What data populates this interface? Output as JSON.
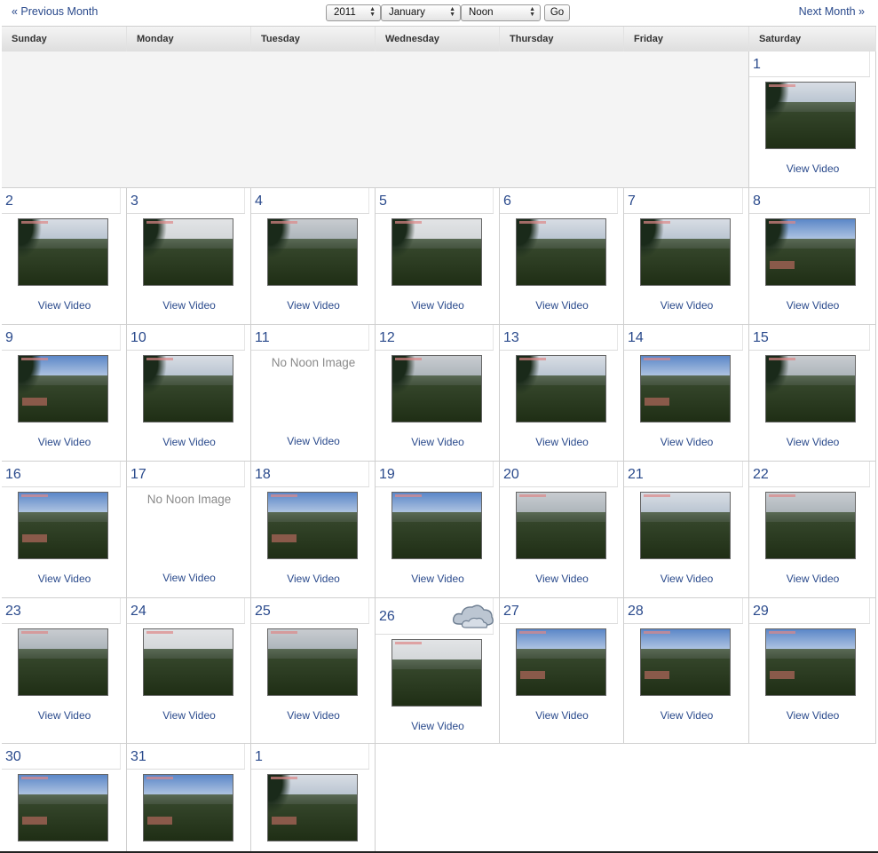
{
  "nav": {
    "prev_label": "« Previous Month",
    "next_label": "Next Month »",
    "year": "2011",
    "month": "January",
    "time": "Noon",
    "go_label": "Go"
  },
  "weekdays": [
    "Sunday",
    "Monday",
    "Tuesday",
    "Wednesday",
    "Thursday",
    "Friday",
    "Saturday"
  ],
  "view_video_label": "View Video",
  "no_image_label": "No Noon Image",
  "days": [
    {
      "label": "1",
      "image": true,
      "sky": "cloud",
      "roof": false,
      "palm": true
    },
    {
      "label": "2",
      "image": true,
      "sky": "cloud",
      "roof": false,
      "palm": true
    },
    {
      "label": "3",
      "image": true,
      "sky": "fog",
      "roof": false,
      "palm": true
    },
    {
      "label": "4",
      "image": true,
      "sky": "grey",
      "roof": false,
      "palm": true
    },
    {
      "label": "5",
      "image": true,
      "sky": "fog",
      "roof": false,
      "palm": true
    },
    {
      "label": "6",
      "image": true,
      "sky": "cloud",
      "roof": false,
      "palm": true
    },
    {
      "label": "7",
      "image": true,
      "sky": "cloud",
      "roof": false,
      "palm": true
    },
    {
      "label": "8",
      "image": true,
      "sky": "blue",
      "roof": true,
      "palm": true
    },
    {
      "label": "9",
      "image": true,
      "sky": "blue",
      "roof": true,
      "palm": true
    },
    {
      "label": "10",
      "image": true,
      "sky": "cloud",
      "roof": false,
      "palm": true
    },
    {
      "label": "11",
      "image": false
    },
    {
      "label": "12",
      "image": true,
      "sky": "grey",
      "roof": false,
      "palm": true
    },
    {
      "label": "13",
      "image": true,
      "sky": "cloud",
      "roof": false,
      "palm": true
    },
    {
      "label": "14",
      "image": true,
      "sky": "blue",
      "roof": true,
      "palm": false
    },
    {
      "label": "15",
      "image": true,
      "sky": "grey",
      "roof": false,
      "palm": true
    },
    {
      "label": "16",
      "image": true,
      "sky": "blue",
      "roof": true,
      "palm": false
    },
    {
      "label": "17",
      "image": false
    },
    {
      "label": "18",
      "image": true,
      "sky": "blue",
      "roof": true,
      "palm": false
    },
    {
      "label": "19",
      "image": true,
      "sky": "blue",
      "roof": false,
      "palm": false
    },
    {
      "label": "20",
      "image": true,
      "sky": "grey",
      "roof": false,
      "palm": false
    },
    {
      "label": "21",
      "image": true,
      "sky": "cloud",
      "roof": false,
      "palm": false
    },
    {
      "label": "22",
      "image": true,
      "sky": "grey",
      "roof": false,
      "palm": false
    },
    {
      "label": "23",
      "image": true,
      "sky": "grey",
      "roof": false,
      "palm": false
    },
    {
      "label": "24",
      "image": true,
      "sky": "fog",
      "roof": false,
      "palm": false
    },
    {
      "label": "25",
      "image": true,
      "sky": "grey",
      "roof": false,
      "palm": false
    },
    {
      "label": "26",
      "image": true,
      "sky": "fog",
      "roof": false,
      "palm": false,
      "weather": "cloud-icon"
    },
    {
      "label": "27",
      "image": true,
      "sky": "blue",
      "roof": true,
      "palm": false
    },
    {
      "label": "28",
      "image": true,
      "sky": "blue",
      "roof": true,
      "palm": false
    },
    {
      "label": "29",
      "image": true,
      "sky": "blue",
      "roof": true,
      "palm": false
    },
    {
      "label": "30",
      "image": true,
      "sky": "blue",
      "roof": true,
      "palm": false
    },
    {
      "label": "31",
      "image": true,
      "sky": "blue",
      "roof": true,
      "palm": false
    },
    {
      "label": "1",
      "image": true,
      "sky": "cloud",
      "roof": true,
      "palm": true
    }
  ],
  "colors": {
    "link": "#2a4a8c",
    "muted": "#8a8a8a",
    "grid": "#cfcfcf",
    "blank": "#f4f4f4"
  }
}
